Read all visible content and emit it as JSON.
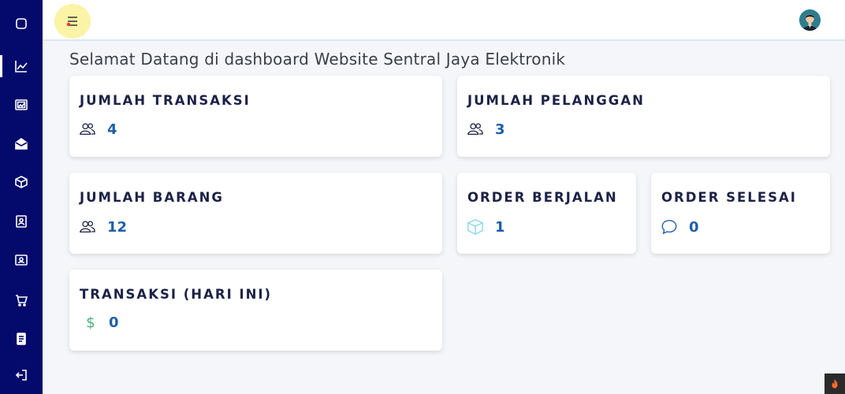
{
  "app": {
    "title": "Selamat Datang di dashboard Website Sentral Jaya Elektronik"
  },
  "colors": {
    "sidebar": "#030a6b",
    "accent_value": "#1f5ea8",
    "card_title": "#1c2246",
    "dollar_icon": "#4cae7b"
  },
  "sidebar": {
    "items": [
      {
        "icon": "square-icon"
      },
      {
        "icon": "chart-line-icon",
        "active": true
      },
      {
        "icon": "image-icon"
      },
      {
        "icon": "envelope-open-icon"
      },
      {
        "icon": "box-icon"
      },
      {
        "icon": "contact-card-icon"
      },
      {
        "icon": "id-badge-icon"
      },
      {
        "icon": "cart-icon"
      },
      {
        "icon": "document-icon"
      },
      {
        "icon": "logout-icon"
      }
    ]
  },
  "topbar": {
    "menu_icon": "hamburger-menu-icon",
    "avatar": "user-avatar"
  },
  "cards": {
    "transaksi": {
      "title": "JUMLAH TRANSAKSI",
      "value": "4",
      "icon": "users-icon"
    },
    "pelanggan": {
      "title": "JUMLAH PELANGGAN",
      "value": "3",
      "icon": "users-icon"
    },
    "barang": {
      "title": "JUMLAH BARANG",
      "value": "12",
      "icon": "users-icon"
    },
    "order_berjalan": {
      "title": "ORDER BERJALAN",
      "value": "1",
      "icon": "box-icon"
    },
    "order_selesai": {
      "title": "ORDER SELESAI",
      "value": "0",
      "icon": "chat-bubble-icon"
    },
    "transaksi_hari_ini": {
      "title": "TRANSAKSI (HARI INI)",
      "value": "0",
      "icon": "dollar-icon"
    }
  }
}
